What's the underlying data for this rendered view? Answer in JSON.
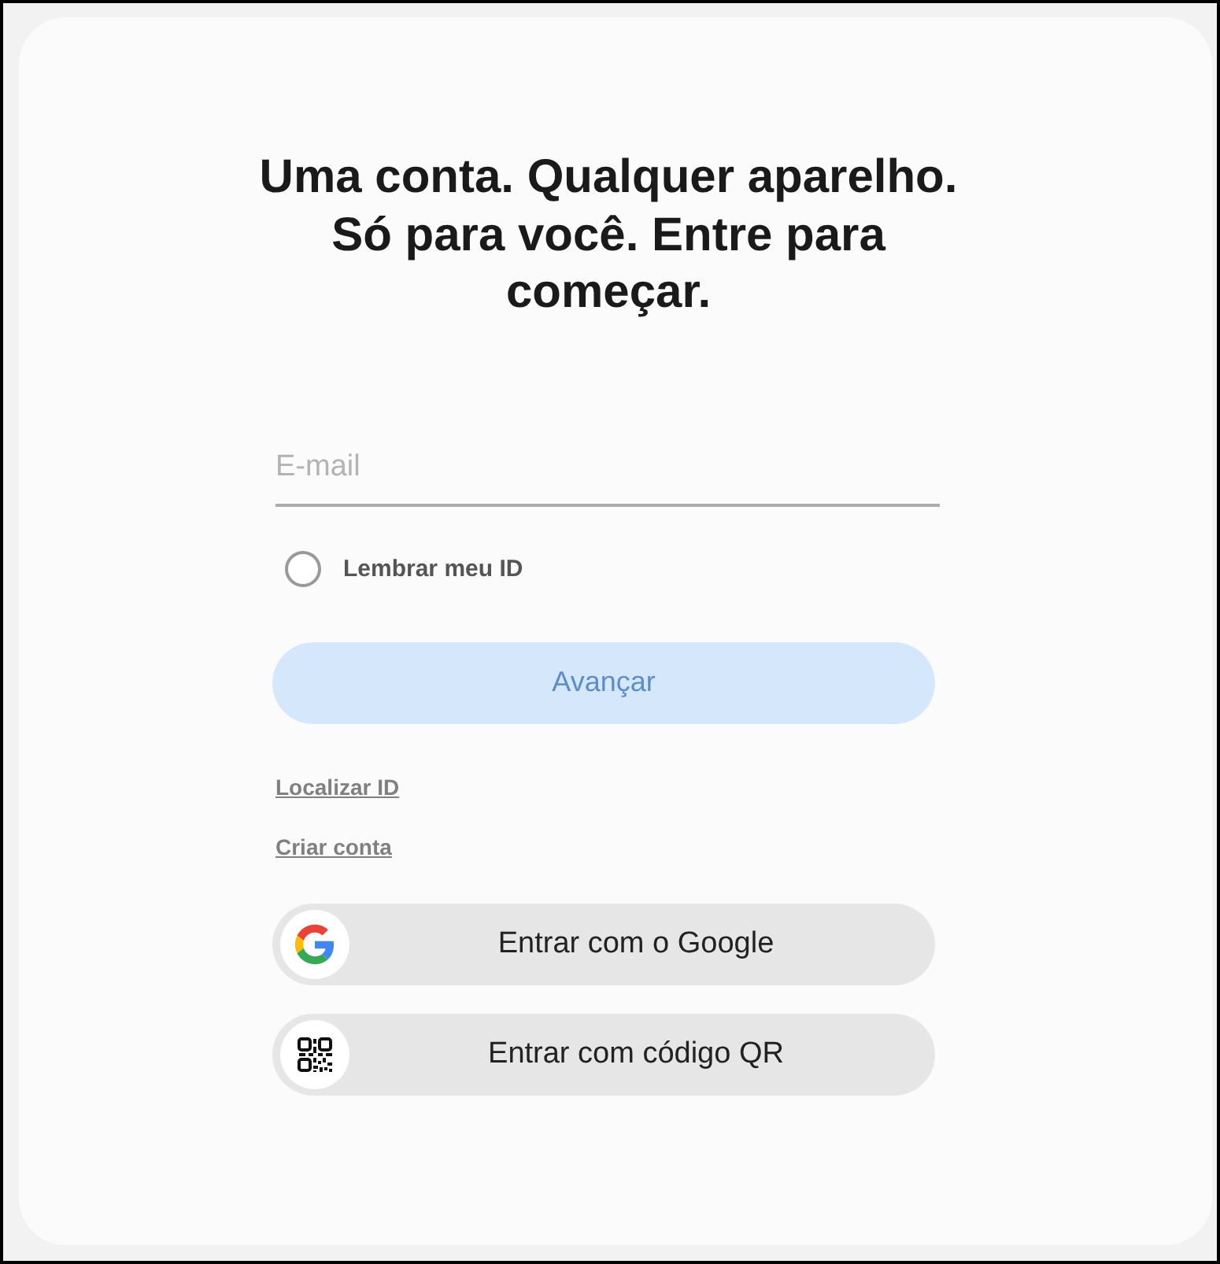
{
  "heading": "Uma conta. Qualquer aparelho. Só para você. Entre para começar.",
  "email_field": {
    "placeholder": "E-mail"
  },
  "remember_id": {
    "label": "Lembrar meu ID",
    "checked": false
  },
  "next_button": {
    "label": "Avançar",
    "disabled": true
  },
  "links": [
    "Localizar ID",
    "Criar conta"
  ],
  "sign_in_options": [
    {
      "kind": "google",
      "label": "Entrar com o Google"
    },
    {
      "kind": "qr",
      "label": "Entrar com código QR"
    }
  ]
}
